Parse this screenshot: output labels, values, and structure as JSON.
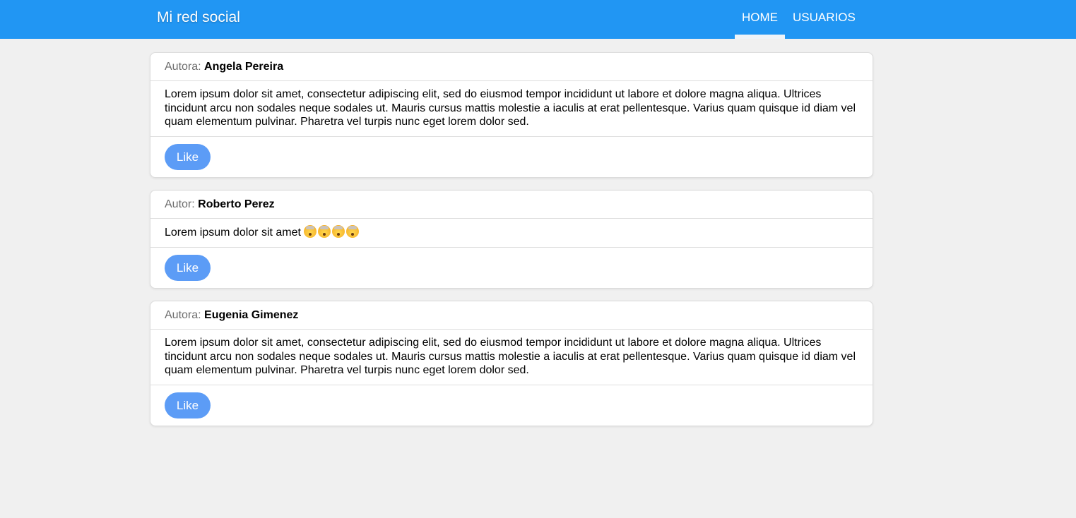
{
  "navbar": {
    "brand": "Mi red social",
    "items": [
      {
        "label": "HOME",
        "active": true
      },
      {
        "label": "USUARIOS",
        "active": false
      }
    ],
    "bg_color": "#2196f3"
  },
  "posts": [
    {
      "author_label": "Autora:",
      "author_name": "Angela Pereira",
      "text": "Lorem ipsum dolor sit amet, consectetur adipiscing elit, sed do eiusmod tempor incididunt ut labore et dolore magna aliqua. Ultrices tincidunt arcu non sodales neque sodales ut. Mauris cursus mattis molestie a iaculis at erat pellentesque. Varius quam quisque id diam vel quam elementum pulvinar. Pharetra vel turpis nunc eget lorem dolor sed.",
      "like_label": "Like"
    },
    {
      "author_label": "Autor:",
      "author_name": "Roberto Perez",
      "text": "Lorem ipsum dolor sit amet",
      "emojis": [
        "exploding-head-icon",
        "exploding-head-icon",
        "exploding-head-icon",
        "exploding-head-icon"
      ],
      "like_label": "Like"
    },
    {
      "author_label": "Autora:",
      "author_name": "Eugenia Gimenez",
      "text": "Lorem ipsum dolor sit amet, consectetur adipiscing elit, sed do eiusmod tempor incididunt ut labore et dolore magna aliqua. Ultrices tincidunt arcu non sodales neque sodales ut. Mauris cursus mattis molestie a iaculis at erat pellentesque. Varius quam quisque id diam vel quam elementum pulvinar. Pharetra vel turpis nunc eget lorem dolor sed.",
      "like_label": "Like"
    }
  ],
  "colors": {
    "page_bg": "#f0f0f0",
    "like_button": "#5c9cf6"
  }
}
